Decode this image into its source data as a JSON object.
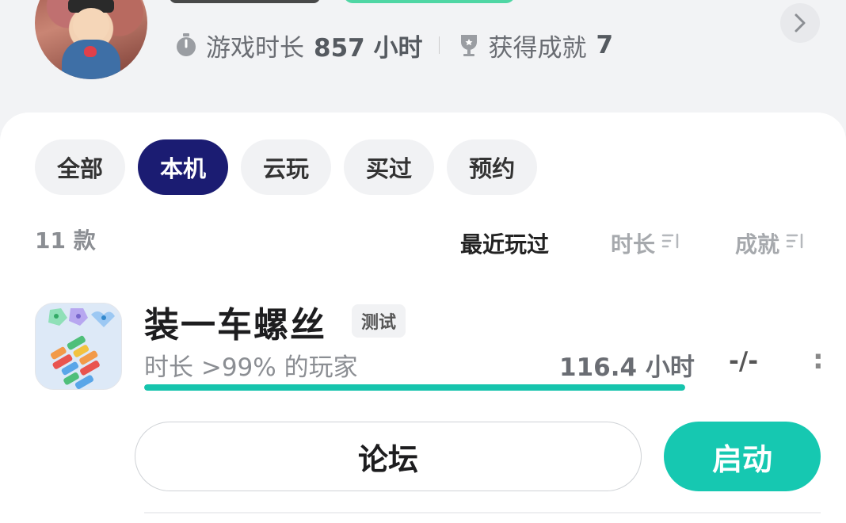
{
  "profile": {
    "stats": {
      "playtime_label": "游戏时长",
      "playtime_value": "857 小时",
      "achievements_label": "获得成就",
      "achievements_value": "7"
    }
  },
  "tabs": [
    {
      "label": "全部",
      "active": false
    },
    {
      "label": "本机",
      "active": true
    },
    {
      "label": "云玩",
      "active": false
    },
    {
      "label": "买过",
      "active": false
    },
    {
      "label": "预约",
      "active": false
    }
  ],
  "list": {
    "count": "11 款",
    "sort": {
      "recent": "最近玩过",
      "duration": "时长",
      "achievements": "成就"
    }
  },
  "game": {
    "title": "装一车螺丝",
    "badge": "测试",
    "rank_text": "时长 >99% 的玩家",
    "hours": "116.4 小时",
    "achievements": "-/-",
    "progress": 1.0,
    "forum_label": "论坛",
    "launch_label": "启动"
  },
  "colors": {
    "accent": "#16c8b1",
    "tab_active": "#1b1c72"
  }
}
